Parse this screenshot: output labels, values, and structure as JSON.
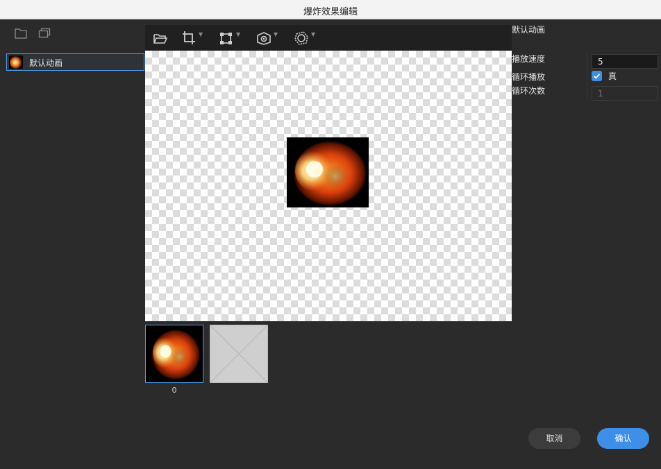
{
  "window": {
    "title": "爆炸效果编辑"
  },
  "left_panel": {
    "icons": [
      "folder-icon",
      "copy-icon"
    ],
    "animations": [
      {
        "label": "默认动画",
        "selected": true
      }
    ]
  },
  "toolbar": {
    "buttons": [
      "open-folder-icon",
      "crop-icon",
      "transform-icon",
      "pivot-icon",
      "collision-shape-icon"
    ]
  },
  "frames": [
    {
      "index": "0",
      "selected": true
    },
    {
      "index": "",
      "selected": false,
      "empty": true
    }
  ],
  "properties": {
    "title": "默认动画",
    "speed_label": "播放速度",
    "speed_value": "5",
    "loop_label": "循环播放",
    "loop_checked": true,
    "loop_value_label": "真",
    "count_label": "循环次数",
    "count_placeholder": "1"
  },
  "buttons": {
    "cancel": "取消",
    "confirm": "确认"
  },
  "colors": {
    "accent": "#3d8fe8",
    "panel_bg": "#2b2b2b",
    "toolbar_bg": "#202020"
  }
}
